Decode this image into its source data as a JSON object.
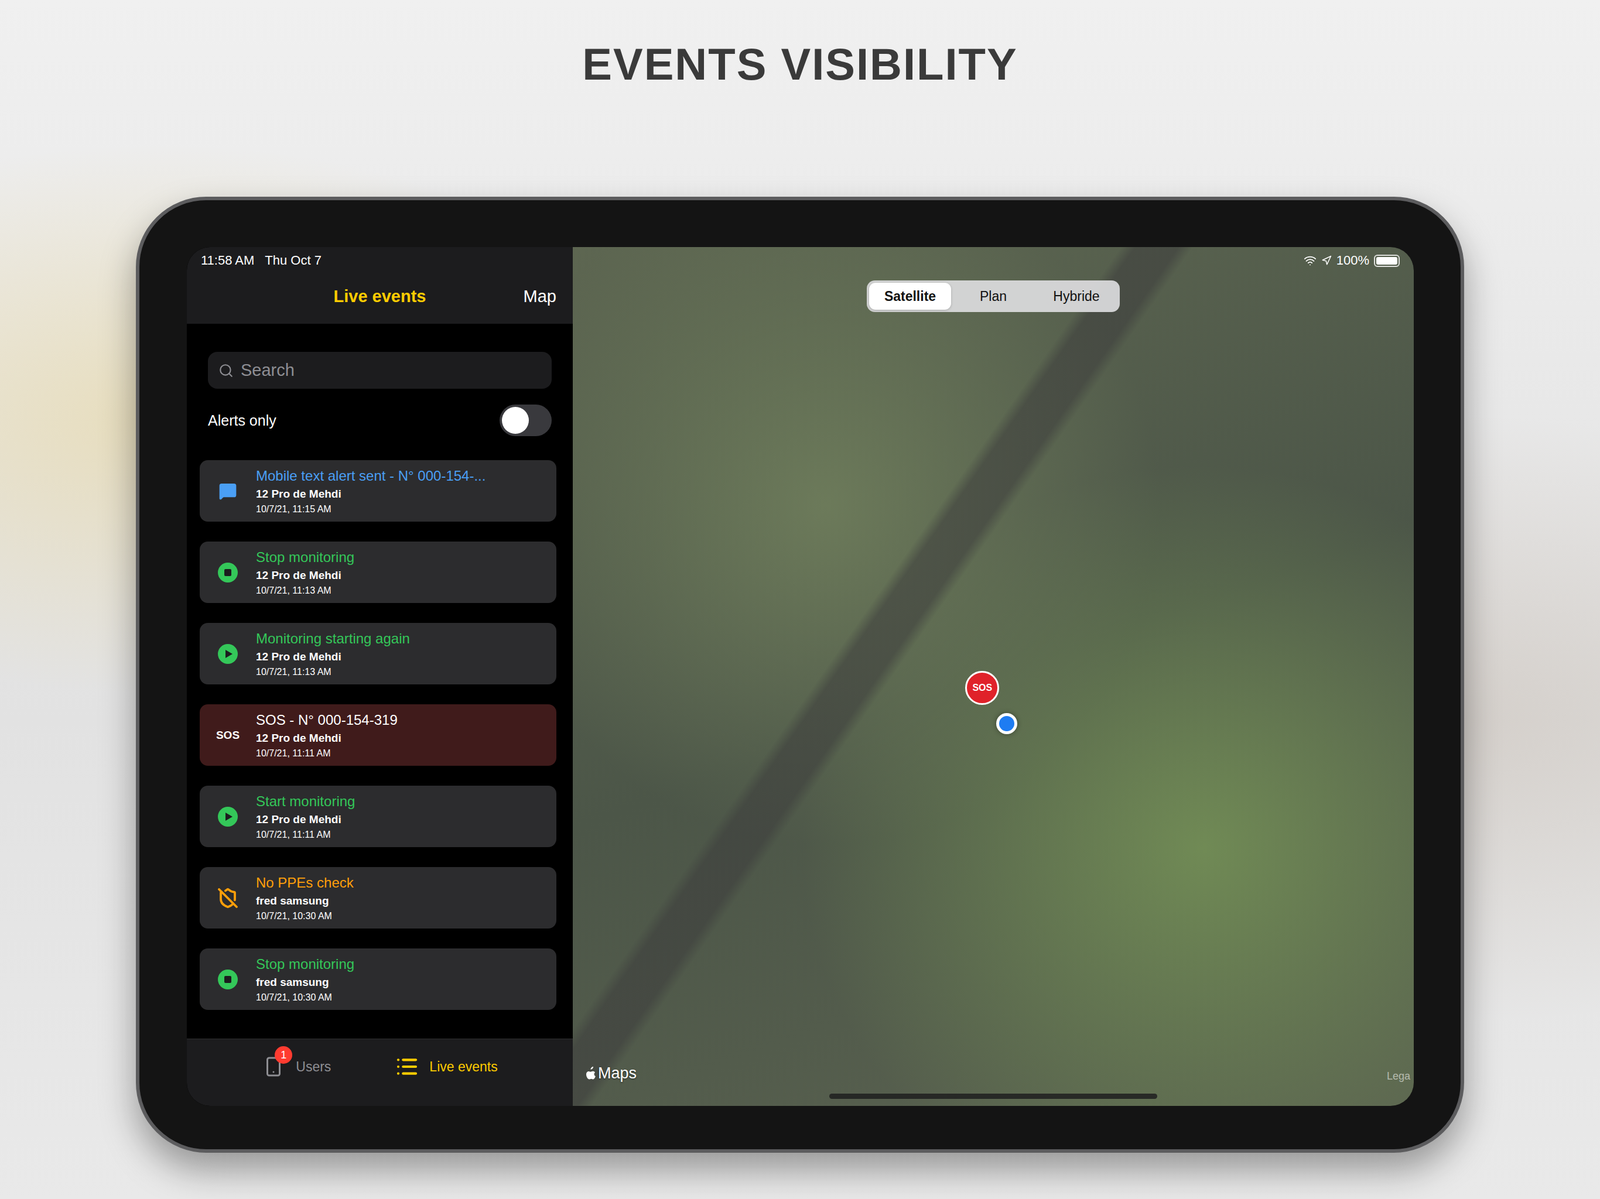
{
  "page": {
    "heading": "EVENTS VISIBILITY"
  },
  "status_bar": {
    "time": "11:58 AM",
    "date": "Thu Oct 7",
    "battery": "100%",
    "battery_level": 1
  },
  "nav": {
    "title": "Live events",
    "action": "Map"
  },
  "search": {
    "placeholder": "Search"
  },
  "filter": {
    "label": "Alerts only",
    "on": false
  },
  "events": [
    {
      "kind": "message",
      "title": "Mobile text alert sent - N° 000-154-...",
      "user": "12 Pro de Mehdi",
      "time": "10/7/21, 11:15 AM",
      "color": "#4a9ff5"
    },
    {
      "kind": "stop",
      "title": "Stop monitoring",
      "user": "12 Pro de Mehdi",
      "time": "10/7/21, 11:13 AM",
      "color": "#34c759"
    },
    {
      "kind": "play",
      "title": "Monitoring starting again",
      "user": "12 Pro de Mehdi",
      "time": "10/7/21, 11:13 AM",
      "color": "#34c759"
    },
    {
      "kind": "sos",
      "title": "SOS - N° 000-154-319",
      "user": "12 Pro de Mehdi",
      "time": "10/7/21, 11:11 AM",
      "color": "#ffffff",
      "icon_text": "SOS"
    },
    {
      "kind": "play",
      "title": "Start monitoring",
      "user": "12 Pro de Mehdi",
      "time": "10/7/21, 11:11 AM",
      "color": "#34c759"
    },
    {
      "kind": "ppe",
      "title": "No PPEs check",
      "user": "fred samsung",
      "time": "10/7/21, 10:30 AM",
      "color": "#ff9f0a"
    },
    {
      "kind": "stop",
      "title": "Stop monitoring",
      "user": "fred samsung",
      "time": "10/7/21, 10:30 AM",
      "color": "#34c759"
    }
  ],
  "tab_bar": [
    {
      "kind": "users",
      "label": "Users",
      "selected": false,
      "badge": "1"
    },
    {
      "kind": "events",
      "label": "Live events",
      "selected": true
    }
  ],
  "map": {
    "segments": [
      {
        "label": "Satellite",
        "selected": true
      },
      {
        "label": "Plan",
        "selected": false
      },
      {
        "label": "Hybride",
        "selected": false
      }
    ],
    "pins": [
      {
        "kind": "sos",
        "label": "SOS"
      },
      {
        "kind": "location"
      }
    ],
    "attribution": "Maps",
    "legal": "Lega"
  }
}
